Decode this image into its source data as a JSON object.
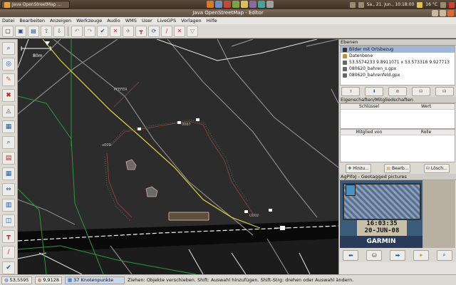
{
  "panel": {
    "task_label": "Java OpenStreetMap ...",
    "clock": "Sa., 21. Jun., 10:18:00",
    "temperature": "16 °C"
  },
  "window": {
    "title": "Java OpenStreetMap - Editor"
  },
  "menu": [
    "Datei",
    "Bearbeiten",
    "Anzeigen",
    "Werkzeuge",
    "Audio",
    "WMS",
    "User",
    "LiveGPS",
    "Vorlagen",
    "Hilfe"
  ],
  "toolbar": {
    "icons": [
      "new-icon",
      "save-icon",
      "open-icon",
      "upload-icon",
      "download-icon",
      "undo-icon",
      "redo-icon",
      "check-icon",
      "tool-icon",
      "tool-icon",
      "tool-icon",
      "tool-icon",
      "tool-icon",
      "tool-icon",
      "tool-icon"
    ]
  },
  "map": {
    "scale_label": "80m",
    "labels": [
      {
        "text": "PFEFER"
      },
      {
        "text": "u009"
      },
      {
        "text": "0067"
      },
      {
        "text": "U002"
      }
    ]
  },
  "layers_panel": {
    "title": "Ebenen",
    "items": [
      {
        "label": "Bilder mit Ortsbezug",
        "selected": true
      },
      {
        "label": "Datenbene",
        "selected": false
      },
      {
        "label": "53.5574233 9.8911071 x 53.573316 9.927713",
        "selected": false
      },
      {
        "label": "080620_bahren_s.gpx",
        "selected": false
      },
      {
        "label": "080620_bahrenfeld.gpx",
        "selected": false
      }
    ]
  },
  "properties_panel": {
    "title": "Eigenschaften/Mitgliedschaften",
    "col_key": "Schlüssel",
    "col_value": "Wert",
    "col_member": "Mitglied von",
    "col_role": "Rolle",
    "btn_add": "Hinzu...",
    "btn_edit": "Bearb...",
    "btn_delete": "Lösch..."
  },
  "photo_panel": {
    "title": "AgPifoJ - Geotagged pictures",
    "time": "16:03:35",
    "date": "20-JUN-08",
    "brand": "GARMIN"
  },
  "status": {
    "lat": "53,5595",
    "lon": "9,9128",
    "nodes": "37 Knotenpunkte",
    "message": "Ziehen: Objekte verschieben. Shift: Auswahl hinzufügen. Shift-Strg: drehen oder Auswahl ändern."
  }
}
